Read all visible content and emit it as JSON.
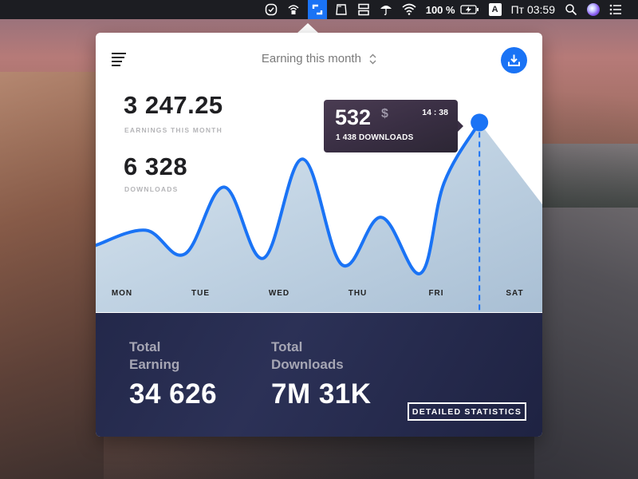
{
  "menubar": {
    "battery_percent": "100 %",
    "input_source": "A",
    "clock": "Пт 03:59",
    "icons": [
      "checkmark-shield-icon",
      "wifi-lock-icon",
      "app-active-icon",
      "drive-icon",
      "layout-icon",
      "umbrella-icon",
      "wifi-icon",
      "battery-charging-icon",
      "input-source-icon",
      "spotlight-search-icon",
      "siri-icon",
      "notification-center-icon"
    ]
  },
  "popover": {
    "period_selector": "Earning this month",
    "earnings_value": "3 247.25",
    "earnings_label": "EARNINGS THIS MONTH",
    "downloads_value": "6 328",
    "downloads_label": "DOWNLOADS",
    "tooltip": {
      "amount": "532",
      "currency": "$",
      "time": "14 : 38",
      "downloads": "1 438 DOWNLOADS"
    },
    "footer": {
      "total_earning_title_line1": "Total",
      "total_earning_title_line2": "Earning",
      "total_earning_value": "34 626",
      "total_downloads_title_line1": "Total",
      "total_downloads_title_line2": "Downloads",
      "total_downloads_value": "7M 31K",
      "detail_button": "DETAILED STATISTICS"
    }
  },
  "colors": {
    "accent": "#1a73f5",
    "text_dark": "#1f1f22",
    "label_gray": "#b5b5b8",
    "footer_bg": "#23284a",
    "area_fill": "#c2d5e6"
  },
  "chart_data": {
    "type": "line",
    "title": "Earning this month",
    "categories": [
      "MON",
      "TUE",
      "WED",
      "THU",
      "FRI",
      "SAT"
    ],
    "x": [
      0,
      0.3,
      0.8,
      1.3,
      1.8,
      2.3,
      2.8,
      3.3,
      3.8,
      4.1,
      4.55,
      5.0
    ],
    "series": [
      {
        "name": "Earnings",
        "values": [
          0.31,
          0.38,
          0.27,
          0.58,
          0.25,
          0.71,
          0.22,
          0.44,
          0.18,
          0.6,
          0.88,
          0.5
        ]
      }
    ],
    "highlighted_point": {
      "index": 10,
      "value": 532,
      "currency": "$",
      "time": "14 : 38",
      "downloads": 1438
    },
    "ylim": [
      0,
      1
    ],
    "grid": false,
    "legend": "none",
    "xlabel": "",
    "ylabel": ""
  }
}
